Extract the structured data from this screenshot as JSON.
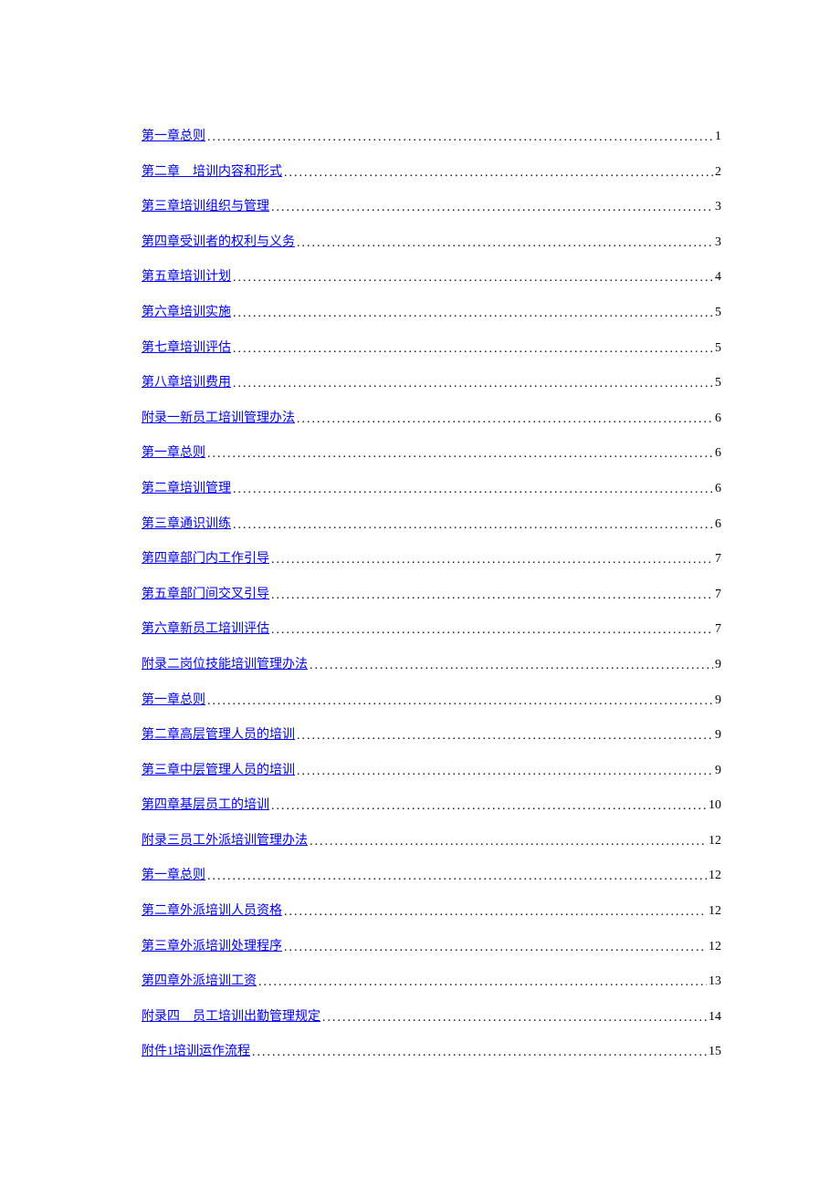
{
  "toc": [
    {
      "label": "第一章总则",
      "page": "1"
    },
    {
      "label": "第二章　培训内容和形式",
      "page": "2"
    },
    {
      "label": "第三章培训组织与管理",
      "page": "3"
    },
    {
      "label": "第四章受训者的权利与义务",
      "page": "3"
    },
    {
      "label": "第五章培训计划",
      "page": "4"
    },
    {
      "label": "第六章培训实施",
      "page": "5"
    },
    {
      "label": "第七章培训评估",
      "page": "5"
    },
    {
      "label": "第八章培训费用",
      "page": "5"
    },
    {
      "label": "附录一新员工培训管理办法",
      "page": "6"
    },
    {
      "label": "第一章总则",
      "page": "6"
    },
    {
      "label": "第二章培训管理",
      "page": "6"
    },
    {
      "label": "第三章通识训练",
      "page": "6"
    },
    {
      "label": "第四章部门内工作引导",
      "page": "7"
    },
    {
      "label": "第五章部门间交叉引导",
      "page": "7"
    },
    {
      "label": "第六章新员工培训评估",
      "page": "7"
    },
    {
      "label": "附录二岗位技能培训管理办法",
      "page": "9"
    },
    {
      "label": "第一章总则",
      "page": "9"
    },
    {
      "label": "第二章高层管理人员的培训",
      "page": "9"
    },
    {
      "label": "第三章中层管理人员的培训",
      "page": "9"
    },
    {
      "label": "第四章基层员工的培训",
      "page": "10"
    },
    {
      "label": "附录三员工外派培训管理办法",
      "page": "12"
    },
    {
      "label": "第一章总则",
      "page": "12"
    },
    {
      "label": "第二章外派培训人员资格",
      "page": "12"
    },
    {
      "label": "第三章外派培训处理程序",
      "page": "12"
    },
    {
      "label": "第四章外派培训工资",
      "page": "13"
    },
    {
      "label": "附录四　员工培训出勤管理规定",
      "page": "14"
    },
    {
      "label": "附件1培训运作流程",
      "page": "15"
    }
  ]
}
